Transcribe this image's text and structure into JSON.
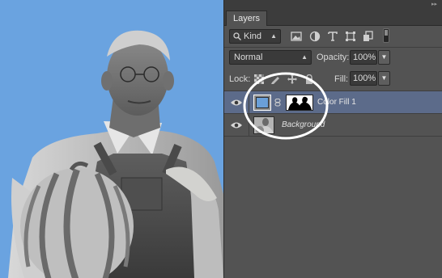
{
  "panel": {
    "tab_label": "Layers",
    "collapse_glyph": "▸▸"
  },
  "filter": {
    "kind_label": "Kind",
    "icons": [
      "search-icon",
      "image-filter-icon",
      "adjustment-filter-icon",
      "type-filter-icon",
      "shape-filter-icon",
      "smart-object-filter-icon",
      "filter-toggle-icon"
    ]
  },
  "blend": {
    "mode": "Normal",
    "opacity_label": "Opacity:",
    "opacity_value": "100%"
  },
  "lock": {
    "label": "Lock:",
    "icons": [
      "lock-transparent-icon",
      "lock-image-icon",
      "lock-position-icon",
      "lock-all-icon"
    ],
    "fill_label": "Fill:",
    "fill_value": "100%"
  },
  "layers": [
    {
      "name": "Color Fill 1",
      "selected": true,
      "fill_color": "#6a9fd8"
    },
    {
      "name": "Background",
      "selected": false
    }
  ],
  "canvas": {
    "background_color": "#6aa3e0"
  },
  "annotation": {
    "highlight": "white-ellipse-around-thumbnails"
  },
  "colors": {
    "panel_bg": "#535353",
    "selected_row": "#5c6b8a",
    "annotation": "#ffffff"
  }
}
